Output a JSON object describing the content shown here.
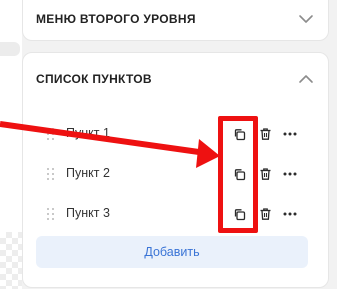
{
  "top_section": {
    "title": "МЕНЮ ВТОРОГО УРОВНЯ",
    "toggle_icon": "chevron-down-icon"
  },
  "list_section": {
    "title": "СПИСОК ПУНКТОВ",
    "toggle_icon": "chevron-up-icon",
    "items": [
      {
        "label": "Пункт 1"
      },
      {
        "label": "Пункт 2"
      },
      {
        "label": "Пункт 3"
      }
    ],
    "actions": [
      "duplicate-icon",
      "trash-icon",
      "more-icon"
    ],
    "add_label": "Добавить"
  },
  "colors": {
    "accent": "#3a74d6",
    "add_button_bg": "#eaf1fb",
    "annotation_red": "#ee1111",
    "panel_bg": "#ffffff",
    "page_bg": "#f2f2f2"
  }
}
